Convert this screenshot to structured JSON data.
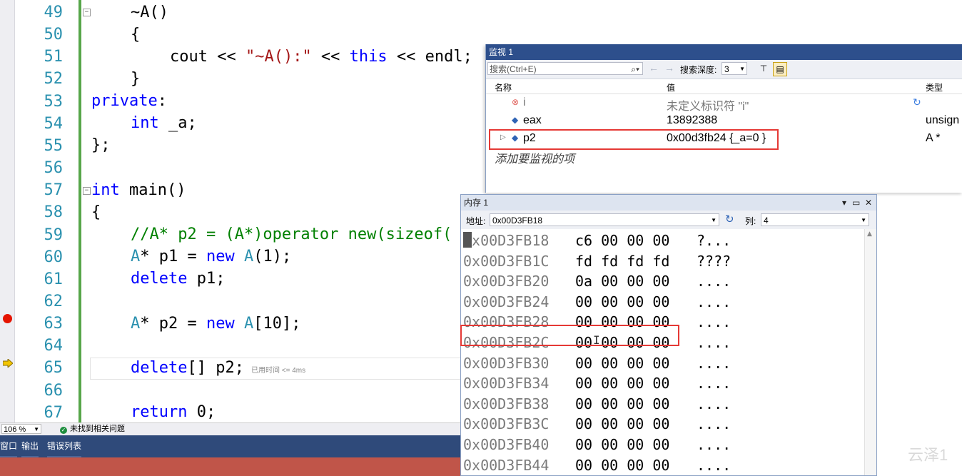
{
  "editor": {
    "lines": [
      {
        "num": "49"
      },
      {
        "num": "50"
      },
      {
        "num": "51"
      },
      {
        "num": "52"
      },
      {
        "num": "53"
      },
      {
        "num": "54"
      },
      {
        "num": "55"
      },
      {
        "num": "56"
      },
      {
        "num": "57"
      },
      {
        "num": "58"
      },
      {
        "num": "59"
      },
      {
        "num": "60"
      },
      {
        "num": "61"
      },
      {
        "num": "62"
      },
      {
        "num": "63"
      },
      {
        "num": "64"
      },
      {
        "num": "65"
      },
      {
        "num": "66"
      },
      {
        "num": "67"
      }
    ],
    "code": {
      "l49": "~A()",
      "l50": "{",
      "l51_a": "cout << ",
      "l51_str": "\"~A():\"",
      "l51_b": " << ",
      "l51_kw": "this",
      "l51_c": " << endl;",
      "l52": "}",
      "l53_kw": "private",
      "l53_b": ":",
      "l54_kw": "int",
      "l54_b": " _a;",
      "l55": "};",
      "l57_kw": "int",
      "l57_b": " main()",
      "l58": "{",
      "l59": "//A* p2 = (A*)operator new(sizeof(",
      "l60_cls": "A",
      "l60_b": "* p1 = ",
      "l60_kw": "new",
      "l60_sp": " ",
      "l60_cls2": "A",
      "l60_c": "(1);",
      "l61_kw": "delete",
      "l61_b": " p1;",
      "l63_cls": "A",
      "l63_b": "* p2 = ",
      "l63_kw": "new",
      "l63_sp": " ",
      "l63_cls2": "A",
      "l63_c": "[10];",
      "l65_kw": "delete",
      "l65_b": "[] p2;",
      "l65_perf": "已用时间 <= 4ms",
      "l67_kw": "return",
      "l67_b": " 0;"
    }
  },
  "status": {
    "zoom": "106 %",
    "issues": "未找到相关问题"
  },
  "bottom_tabs": [
    "窗口",
    "输出",
    "错误列表"
  ],
  "watch": {
    "title": "监视 1",
    "search_placeholder": "搜索(Ctrl+E)",
    "depth_label": "搜索深度:",
    "depth_value": "3",
    "columns": {
      "name": "名称",
      "value": "值",
      "type": "类型"
    },
    "rows": [
      {
        "name": "i",
        "value": "未定义标识符 \"i\"",
        "type": "",
        "icon": "error-icon"
      },
      {
        "name": "eax",
        "value": "13892388",
        "type": "unsign",
        "icon": "variable-icon"
      },
      {
        "name": "p2",
        "value": "0x00d3fb24 {_a=0 }",
        "type": "A *",
        "icon": "variable-icon"
      }
    ],
    "add_hint": "添加要监视的项"
  },
  "memory": {
    "title": "内存 1",
    "address_label": "地址:",
    "address_value": "0x00D3FB18",
    "columns_label": "列:",
    "columns_value": "4",
    "rows": [
      {
        "addr": "0x00D3FB18",
        "hex": "c6 00 00 00",
        "ascii": "?..."
      },
      {
        "addr": "0x00D3FB1C",
        "hex": "fd fd fd fd",
        "ascii": "????"
      },
      {
        "addr": "0x00D3FB20",
        "hex": "0a 00 00 00",
        "ascii": "...."
      },
      {
        "addr": "0x00D3FB24",
        "hex": "00 00 00 00",
        "ascii": "...."
      },
      {
        "addr": "0x00D3FB28",
        "hex": "00 00 00 00",
        "ascii": "...."
      },
      {
        "addr": "0x00D3FB2C",
        "hex": "00 00 00 00",
        "ascii": "...."
      },
      {
        "addr": "0x00D3FB30",
        "hex": "00 00 00 00",
        "ascii": "...."
      },
      {
        "addr": "0x00D3FB34",
        "hex": "00 00 00 00",
        "ascii": "...."
      },
      {
        "addr": "0x00D3FB38",
        "hex": "00 00 00 00",
        "ascii": "...."
      },
      {
        "addr": "0x00D3FB3C",
        "hex": "00 00 00 00",
        "ascii": "...."
      },
      {
        "addr": "0x00D3FB40",
        "hex": "00 00 00 00",
        "ascii": "...."
      },
      {
        "addr": "0x00D3FB44",
        "hex": "00 00 00 00",
        "ascii": "...."
      }
    ]
  },
  "watermark": "云泽1",
  "colors": {
    "keyword": "#0000ff",
    "class": "#2b91af",
    "string": "#a31515",
    "comment": "#008000",
    "highlight_box": "#e53935",
    "title_bar": "#2d4f8c"
  }
}
